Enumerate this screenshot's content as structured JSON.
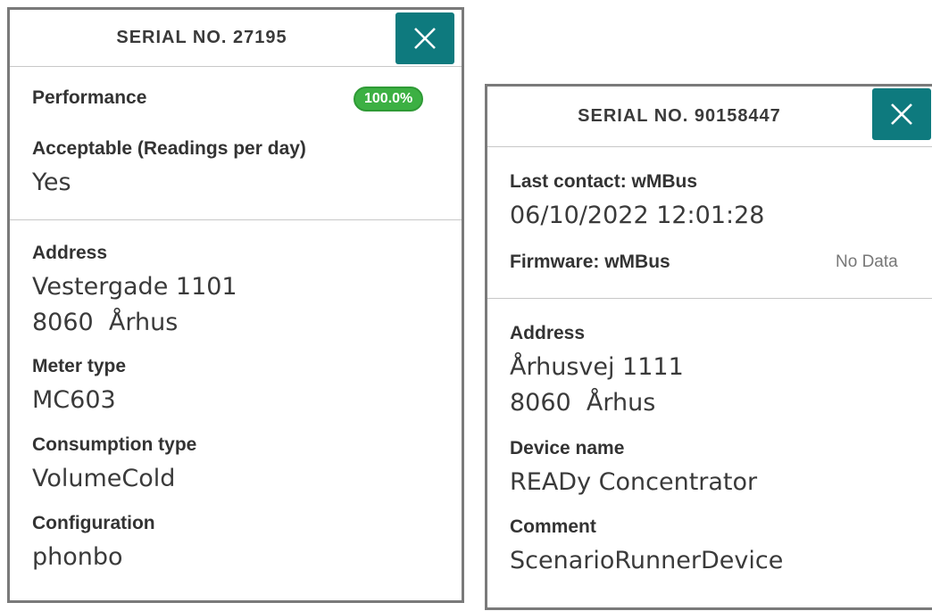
{
  "colors": {
    "accent": "#0e7a7e",
    "badge_green": "#3cb043"
  },
  "left_panel": {
    "serial": "SERIAL NO. 27195",
    "close_icon": "close-icon",
    "performance_label": "Performance",
    "performance_badge": "100.0%",
    "acceptable_label": "Acceptable (Readings per day)",
    "acceptable_value": "Yes",
    "address_label": "Address",
    "address_line1": "Vestergade 1101",
    "address_line2": "8060  Århus",
    "meter_type_label": "Meter type",
    "meter_type_value": "MC603",
    "consumption_type_label": "Consumption type",
    "consumption_type_value": "VolumeCold",
    "configuration_label": "Configuration",
    "configuration_value": "phonbo"
  },
  "right_panel": {
    "serial": "SERIAL NO. 90158447",
    "close_icon": "close-icon",
    "last_contact_label": "Last contact: wMBus",
    "last_contact_value": "06/10/2022 12:01:28",
    "firmware_label": "Firmware: wMBus",
    "firmware_value": "No Data",
    "address_label": "Address",
    "address_line1": "Århusvej 1111",
    "address_line2": "8060  Århus",
    "device_name_label": "Device name",
    "device_name_value": "READy Concentrator",
    "comment_label": "Comment",
    "comment_value": "ScenarioRunnerDevice"
  }
}
